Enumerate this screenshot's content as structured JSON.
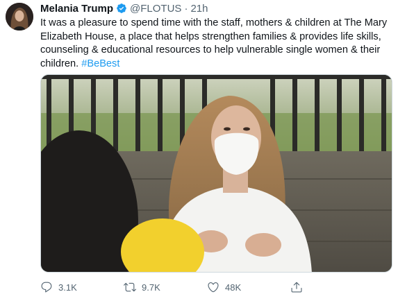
{
  "tweet": {
    "name": "Melania Trump",
    "handle": "@FLOTUS",
    "dot": "·",
    "time": "21h",
    "text_main": "It was a pleasure to spend time with the staff, mothers & children at The Mary Elizabeth House, a place that helps strengthen families & provides life skills, counseling & educational resources to help vulnerable single women & their children.",
    "hashtag": "#BeBest",
    "verified": true,
    "accent_color": "#1d9bf0"
  },
  "actions": {
    "reply_count": "3.1K",
    "retweet_count": "9.7K",
    "like_count": "48K",
    "icons": [
      "reply-icon",
      "retweet-icon",
      "like-icon",
      "share-icon"
    ]
  }
}
